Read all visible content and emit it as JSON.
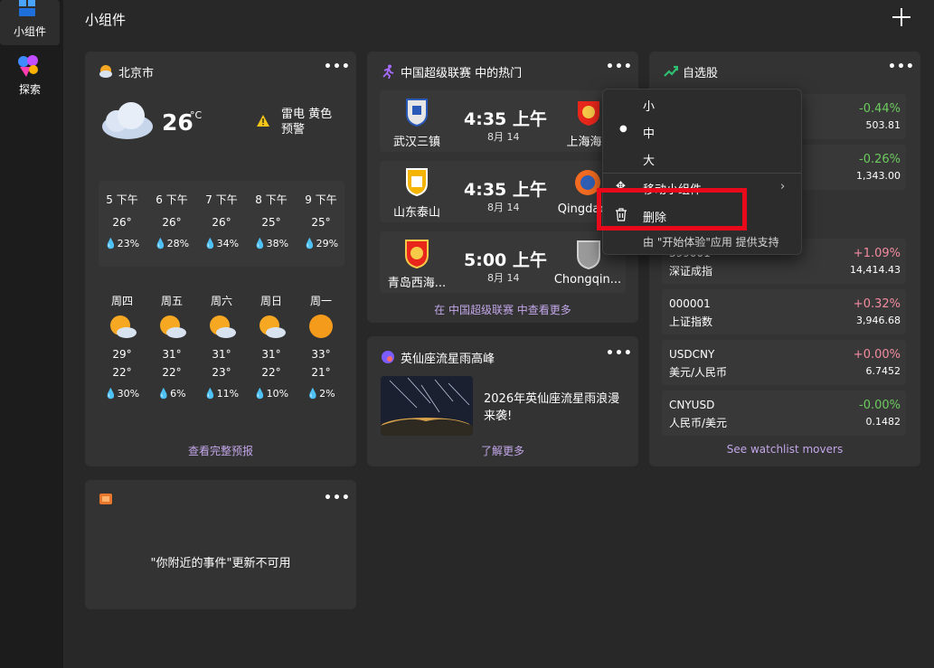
{
  "sidebar": {
    "items": [
      {
        "label": "小组件",
        "icon": "widgets-icon"
      },
      {
        "label": "探索",
        "icon": "explore-icon"
      }
    ]
  },
  "header": {
    "title": "小组件",
    "add_icon": "plus-icon"
  },
  "weather": {
    "title": "北京市",
    "temp": "26",
    "unit": "°C",
    "alert": "雷电 黄色 预警",
    "hourly": [
      {
        "time": "5 下午",
        "temp": "26°",
        "rain": "23%"
      },
      {
        "time": "6 下午",
        "temp": "26°",
        "rain": "28%"
      },
      {
        "time": "7 下午",
        "temp": "26°",
        "rain": "34%"
      },
      {
        "time": "8 下午",
        "temp": "25°",
        "rain": "38%"
      },
      {
        "time": "9 下午",
        "temp": "25°",
        "rain": "29%"
      }
    ],
    "daily": [
      {
        "day": "周四",
        "high": "29°",
        "low": "22°",
        "rain": "30%",
        "icon": "partly-sunny-icon"
      },
      {
        "day": "周五",
        "high": "31°",
        "low": "22°",
        "rain": "6%",
        "icon": "partly-sunny-icon"
      },
      {
        "day": "周六",
        "high": "31°",
        "low": "23°",
        "rain": "11%",
        "icon": "partly-sunny-icon"
      },
      {
        "day": "周日",
        "high": "31°",
        "low": "22°",
        "rain": "10%",
        "icon": "partly-sunny-icon"
      },
      {
        "day": "周一",
        "high": "33°",
        "low": "21°",
        "rain": "2%",
        "icon": "sunny-icon"
      }
    ],
    "link": "查看完整预报"
  },
  "sports": {
    "title": "中国超级联赛 中的热门",
    "matches": [
      {
        "home": "武汉三镇",
        "away": "上海海",
        "time": "4:35 上午",
        "date": "8月 14"
      },
      {
        "home": "山东泰山",
        "away": "Qingdao",
        "time": "4:35 上午",
        "date": "8月 14"
      },
      {
        "home": "青岛西海...",
        "away": "Chongqin...",
        "time": "5:00 上午",
        "date": "8月 14"
      }
    ],
    "link": "在 中国超级联赛 中查看更多"
  },
  "news": {
    "title": "英仙座流星雨高峰",
    "headline": "2026年英仙座流星雨浪漫来袭!",
    "link": "了解更多"
  },
  "stocks": {
    "title": "自选股",
    "rows": [
      {
        "symbol": "",
        "name": "",
        "change": "-0.44%",
        "price": "503.81",
        "dir": "down"
      },
      {
        "symbol": "",
        "name": "",
        "change": "-0.26%",
        "price": "1,343.00",
        "dir": "down"
      },
      {
        "symbol": "399001",
        "name": "深证成指",
        "change": "+1.09%",
        "price": "14,414.43",
        "dir": "up"
      },
      {
        "symbol": "000001",
        "name": "上证指数",
        "change": "+0.32%",
        "price": "3,946.68",
        "dir": "up"
      },
      {
        "symbol": "USDCNY",
        "name": "美元/人民币",
        "change": "+0.00%",
        "price": "6.7452",
        "dir": "up"
      },
      {
        "symbol": "CNYUSD",
        "name": "人民币/美元",
        "change": "-0.00%",
        "price": "0.1482",
        "dir": "down"
      }
    ],
    "link": "See watchlist movers"
  },
  "events": {
    "message": "\"你附近的事件\"更新不可用"
  },
  "context_menu": {
    "size_small": "小",
    "size_medium": "中",
    "size_large": "大",
    "move": "移动小组件",
    "delete": "删除",
    "provider": "由 \"开始体验\"应用 提供支持"
  },
  "colors": {
    "positive": "#f38ba0",
    "negative": "#6ccb5f",
    "link": "#c2a6e8",
    "highlight": "#e8091b"
  }
}
